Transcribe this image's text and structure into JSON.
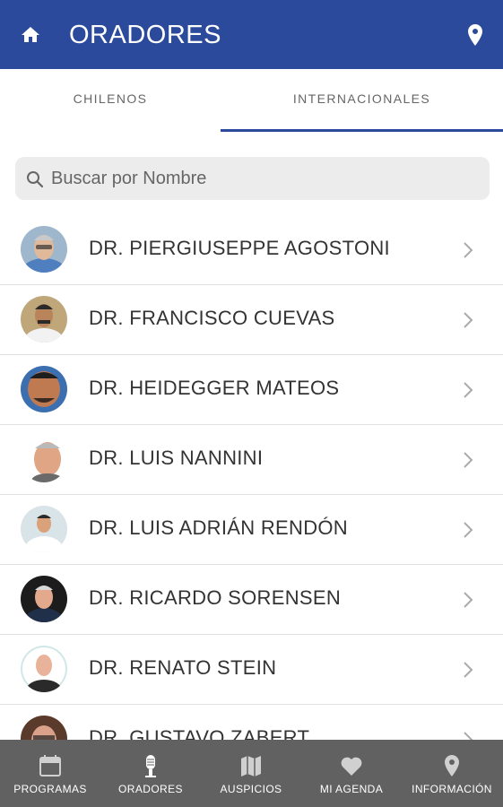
{
  "header": {
    "title": "ORADORES",
    "home_icon": "home-icon",
    "location_icon": "map-pin-icon",
    "bg_color": "#2c4a9c"
  },
  "tabs": [
    {
      "label": "CHILENOS",
      "selected": false
    },
    {
      "label": "INTERNACIONALES",
      "selected": true
    }
  ],
  "search": {
    "placeholder": "Buscar por Nombre",
    "value": ""
  },
  "speakers": [
    {
      "name": "DR. PIERGIUSEPPE AGOSTONI"
    },
    {
      "name": "DR. FRANCISCO CUEVAS"
    },
    {
      "name": "DR. HEIDEGGER MATEOS"
    },
    {
      "name": "DR. LUIS NANNINI"
    },
    {
      "name": "DR. LUIS ADRIÁN RENDÓN"
    },
    {
      "name": "DR. RICARDO SORENSEN"
    },
    {
      "name": "DR. RENATO STEIN"
    },
    {
      "name": "DR. GUSTAVO ZABERT"
    }
  ],
  "bottom_nav": [
    {
      "label": "PROGRAMAS",
      "icon": "calendar-icon"
    },
    {
      "label": "ORADORES",
      "icon": "microphone-icon"
    },
    {
      "label": "AUSPICIOS",
      "icon": "map-icon"
    },
    {
      "label": "MI AGENDA",
      "icon": "heart-icon"
    },
    {
      "label": "INFORMACIÓN",
      "icon": "map-pin-icon"
    }
  ]
}
